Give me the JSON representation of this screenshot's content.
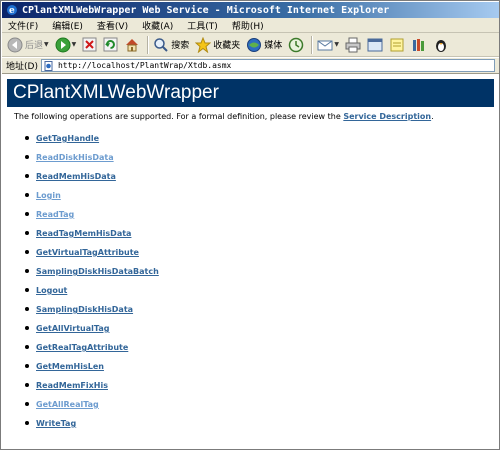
{
  "window": {
    "title": "CPlantXMLWebWrapper Web Service - Microsoft Internet Explorer"
  },
  "menu": {
    "items": [
      "文件(F)",
      "编辑(E)",
      "查看(V)",
      "收藏(A)",
      "工具(T)",
      "帮助(H)"
    ]
  },
  "toolbar": {
    "back_label": "后退",
    "search_label": "搜索",
    "favorites_label": "收藏夹",
    "media_label": "媒体"
  },
  "address": {
    "label": "地址(D)",
    "url": "http://localhost/PlantWrap/Xtdb.asmx"
  },
  "page": {
    "heading": "CPlantXMLWebWrapper",
    "intro_text": "The following operations are supported. For a formal definition, please review the ",
    "intro_link": "Service Description",
    "intro_end": ".",
    "link_color": "#336699",
    "visited_color": "#6d9ccf",
    "banner_color": "#003366",
    "operations": [
      {
        "name": "GetTagHandle",
        "visited": false
      },
      {
        "name": "ReadDiskHisData",
        "visited": true
      },
      {
        "name": "ReadMemHisData",
        "visited": false
      },
      {
        "name": "Login",
        "visited": true
      },
      {
        "name": "ReadTag",
        "visited": true
      },
      {
        "name": "ReadTagMemHisData",
        "visited": false
      },
      {
        "name": "GetVirtualTagAttribute",
        "visited": false
      },
      {
        "name": "SamplingDiskHisDataBatch",
        "visited": false
      },
      {
        "name": "Logout",
        "visited": false
      },
      {
        "name": "SamplingDiskHisData",
        "visited": false
      },
      {
        "name": "GetAllVirtualTag",
        "visited": false
      },
      {
        "name": "GetRealTagAttribute",
        "visited": false
      },
      {
        "name": "GetMemHisLen",
        "visited": false
      },
      {
        "name": "ReadMemFixHis",
        "visited": false
      },
      {
        "name": "GetAllRealTag",
        "visited": true
      },
      {
        "name": "WriteTag",
        "visited": false
      }
    ]
  }
}
